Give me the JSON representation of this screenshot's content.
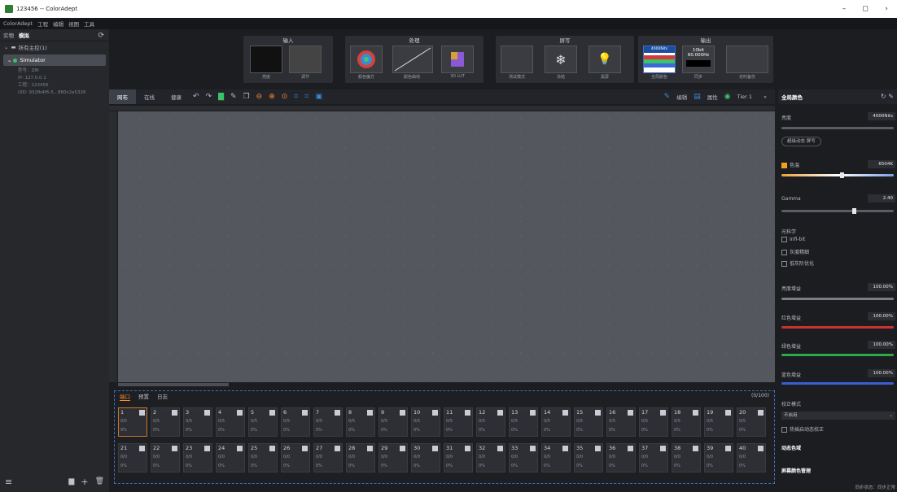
{
  "window": {
    "title": "123456 -- ColorAdept",
    "minimize": "–",
    "restore": "◻",
    "close": "›"
  },
  "menu": [
    "ColorAdept",
    "工程",
    "编辑",
    "视图",
    "工具"
  ],
  "left": {
    "tabs": [
      "实物",
      "模拟"
    ],
    "refresh_icon": "⟳",
    "tree_root": "所有主控(1)",
    "tree_child": "Simulator",
    "info": [
      "型号：Z8t",
      "IP: 127.0.0.1",
      "工程：123456",
      "UID: 932fb4f6-5...880c2a5326"
    ]
  },
  "pipeline": {
    "stages": [
      {
        "title": "输入",
        "items": [
          "亮度",
          "调节"
        ]
      },
      {
        "title": "处理",
        "items": [
          "颜色魔方",
          "颜色曲线",
          "3D LUT"
        ]
      },
      {
        "title": "屏写",
        "items": [
          "测试模式",
          "冻结",
          "黑屏"
        ]
      },
      {
        "title": "输出",
        "items": [
          "全局颜色",
          "同步",
          "定时备份"
        ]
      }
    ],
    "output_badge": "4000Nits",
    "output_fmt": "10bit",
    "output_hz": "60.000Hz"
  },
  "toolbar": {
    "tabs": [
      "网布",
      "在线",
      "健康"
    ],
    "right_items": [
      "编辑",
      "属性",
      "Tier 1"
    ],
    "more": "»"
  },
  "bottom": {
    "tabs": [
      "端口",
      "预置",
      "日志"
    ],
    "count": "(0/100)",
    "row1": [
      "1",
      "2",
      "3",
      "4",
      "5",
      "6",
      "7",
      "8",
      "9",
      "10",
      "11",
      "12",
      "13",
      "14",
      "15",
      "16",
      "17",
      "18",
      "19",
      "20"
    ],
    "row2": [
      "21",
      "22",
      "23",
      "24",
      "25",
      "26",
      "27",
      "28",
      "29",
      "30",
      "31",
      "32",
      "33",
      "34",
      "35",
      "36",
      "37",
      "38",
      "39",
      "40"
    ],
    "row1_frac": "0/5",
    "row2_frac": "0/0",
    "pct": "0%"
  },
  "right": {
    "title": "全局颜色",
    "brightness_label": "亮度",
    "brightness_value": "4000Nits",
    "mode_pill": "超级动态 屏写",
    "temp_label": "色温",
    "temp_value": "6504K",
    "gamma_label": "Gamma",
    "gamma_value": "2.40",
    "optics_label": "光科学",
    "optics_options": [
      "Infi-bit",
      "灰度精细",
      "低灰阶优化"
    ],
    "gain_labels": [
      "亮度增益",
      "红色增益",
      "绿色增益",
      "蓝色增益"
    ],
    "gain_values": [
      "100.00%",
      "100.00%",
      "100.00%",
      "100.00%"
    ],
    "calib_label": "校正模式",
    "calib_value": "不启用",
    "calib_check": "热插启动态校正",
    "dynamic_label": "动态色域",
    "screen_color_label": "屏幕颜色管理",
    "status": "同步状态：同步正常"
  },
  "colors": {
    "accent": "#ff8a2a",
    "select": "#3c6fc0"
  }
}
